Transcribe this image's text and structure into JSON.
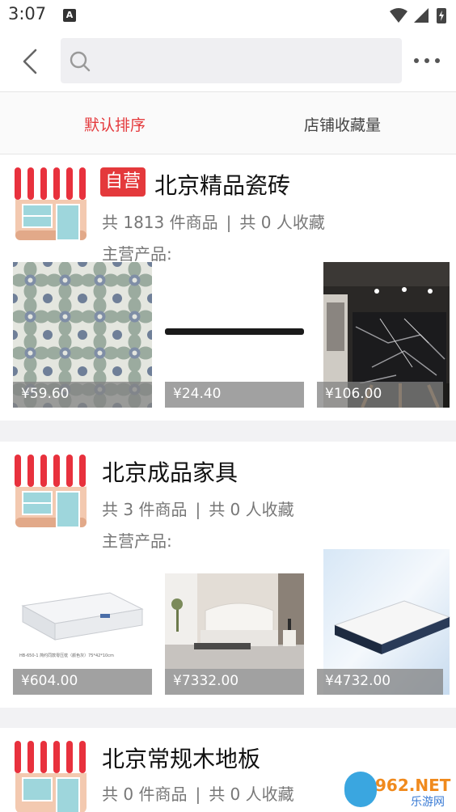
{
  "status": {
    "time": "3:07",
    "notice_icon": "A"
  },
  "header": {
    "search_placeholder": ""
  },
  "sort": {
    "default": "默认排序",
    "favorites": "店铺收藏量"
  },
  "stores": [
    {
      "badge": "自营",
      "name": "北京精品瓷砖",
      "products_count": "共 1813 件商品",
      "separator": "|",
      "favorites": "共 0 人收藏",
      "main_label": "主营产品:",
      "products": [
        {
          "image": "floral-tile",
          "price": "¥59.60"
        },
        {
          "image": "black-strip",
          "price": "¥24.40"
        },
        {
          "image": "marble-slab",
          "price": "¥106.00"
        }
      ]
    },
    {
      "badge": "",
      "name": "北京成品家具",
      "products_count": "共 3 件商品",
      "separator": "|",
      "favorites": "共 0 人收藏",
      "main_label": "主营产品:",
      "products": [
        {
          "image": "white-box",
          "price": "¥604.00",
          "caption": "HB-650-1 简约同款零压枕（颜色灰）75*42*10cm"
        },
        {
          "image": "bedroom",
          "price": "¥7332.00"
        },
        {
          "image": "mattress",
          "price": "¥4732.00"
        }
      ]
    },
    {
      "badge": "",
      "name": "北京常规木地板",
      "products_count": "共 0 件商品",
      "separator": "|",
      "favorites": "共 0 人收藏"
    }
  ],
  "watermark": {
    "number": "962.NET",
    "site": "乐游网"
  },
  "colors": {
    "accent": "#e4393c"
  }
}
